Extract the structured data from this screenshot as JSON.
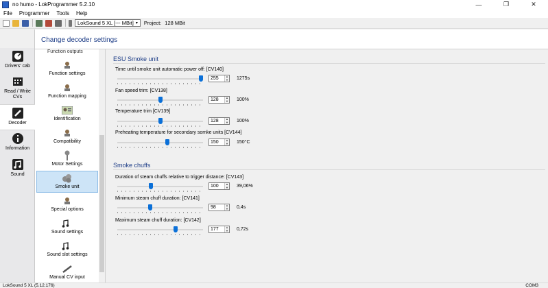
{
  "window": {
    "title": "no humo - LokProgrammer 5.2.10",
    "controls": [
      "minimize-icon",
      "maximize-icon",
      "close-icon"
    ]
  },
  "menu": [
    "File",
    "Programmer",
    "Tools",
    "Help"
  ],
  "toolbar": {
    "decoder_select": "LokSound 5 XL [--- MBit]",
    "project_label": "Project:",
    "project_size": "128 MBit"
  },
  "leftnav": {
    "items": [
      {
        "label": "Drivers' cab",
        "icon": "drivers-cab-icon"
      },
      {
        "label": "Read / Write CVs",
        "icon": "cv-chip-icon"
      },
      {
        "label": "Decoder",
        "icon": "decoder-screwdriver-icon"
      },
      {
        "label": "Information",
        "icon": "info-icon"
      },
      {
        "label": "Sound",
        "icon": "sound-notes-icon"
      }
    ]
  },
  "header": {
    "title": "Change decoder settings"
  },
  "functions": {
    "cut_label": "Function outputs",
    "items": [
      {
        "label": "Function settings",
        "icon": "function-settings-icon"
      },
      {
        "label": "Function mapping",
        "icon": "function-mapping-icon"
      },
      {
        "label": "Identification",
        "icon": "identification-card-icon"
      },
      {
        "label": "Compatibility",
        "icon": "compatibility-icon"
      },
      {
        "label": "Motor Settings",
        "icon": "motor-icon"
      },
      {
        "label": "Smoke unit",
        "icon": "smoke-icon"
      },
      {
        "label": "Special options",
        "icon": "special-options-icon"
      },
      {
        "label": "Sound settings",
        "icon": "sound-settings-icon"
      },
      {
        "label": "Sound slot settings",
        "icon": "sound-slot-icon"
      },
      {
        "label": "Manual CV input",
        "icon": "manual-cv-icon"
      }
    ]
  },
  "smoke_unit": {
    "heading": "ESU Smoke unit",
    "settings": [
      {
        "label": "Time until smoke unit automatic power off: [CV140]",
        "value": "255",
        "display": "1275s",
        "fraction": 1.0
      },
      {
        "label": "Fan speed trim: [CV138]",
        "value": "128",
        "display": "100%",
        "fraction": 0.5
      },
      {
        "label": "Temperature trim [CV139]",
        "value": "128",
        "display": "100%",
        "fraction": 0.5
      },
      {
        "label": "Preheating temperature for secondary somke units [CV144]",
        "value": "150",
        "display": "150°C",
        "fraction": 0.59
      }
    ]
  },
  "smoke_chuffs": {
    "heading": "Smoke chuffs",
    "settings": [
      {
        "label": "Duration of steam chuffs relative to trigger distance: [CV143]",
        "value": "100",
        "display": "39,06%",
        "fraction": 0.39
      },
      {
        "label": "Minimum steam chuff duration: [CV141]",
        "value": "98",
        "display": "0,4s",
        "fraction": 0.38
      },
      {
        "label": "Maximum steam chuff duration: [CV142]",
        "value": "177",
        "display": "0,72s",
        "fraction": 0.69
      }
    ]
  },
  "status": {
    "left": "LokSound 5 XL (5.12.176)",
    "right": "COM3"
  },
  "colors": {
    "accent": "#0b70d8",
    "heading": "#1c3c86",
    "selected_bg": "#cde4f7"
  }
}
